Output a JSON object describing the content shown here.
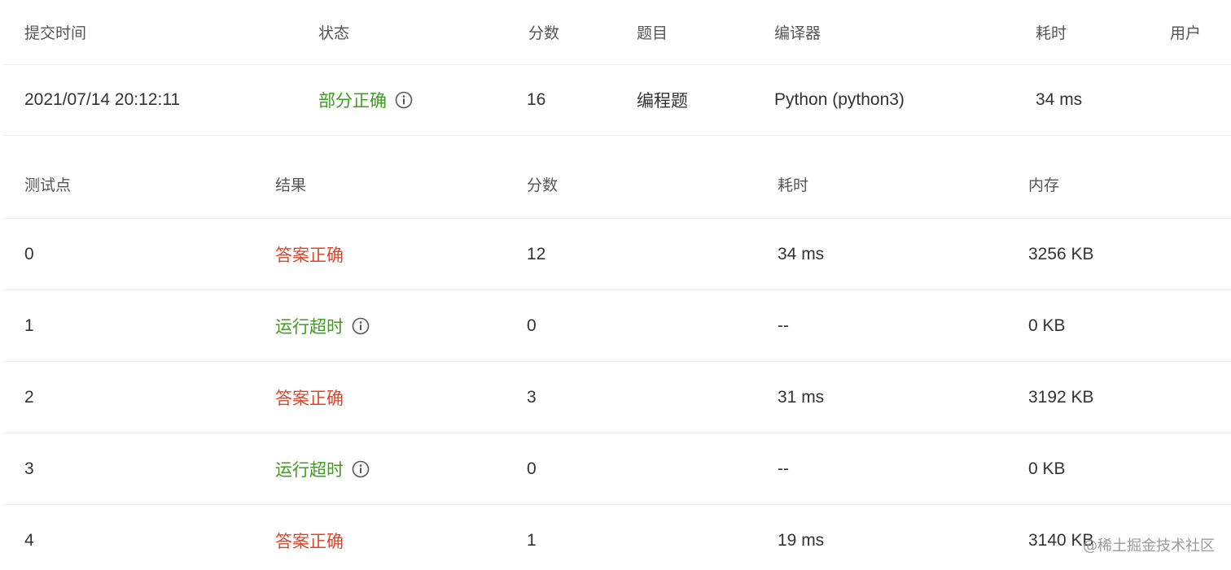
{
  "submission": {
    "headers": {
      "time": "提交时间",
      "status": "状态",
      "score": "分数",
      "problem": "题目",
      "compiler": "编译器",
      "duration": "耗时",
      "user": "用户"
    },
    "row": {
      "time": "2021/07/14 20:12:11",
      "status": "部分正确",
      "score": "16",
      "problem": "编程题",
      "compiler": "Python (python3)",
      "duration": "34 ms",
      "user": ""
    }
  },
  "testpoints": {
    "headers": {
      "id": "测试点",
      "result": "结果",
      "score": "分数",
      "duration": "耗时",
      "memory": "内存"
    },
    "rows": [
      {
        "id": "0",
        "result": "答案正确",
        "score": "12",
        "duration": "34 ms",
        "memory": "3256 KB"
      },
      {
        "id": "1",
        "result": "运行超时",
        "score": "0",
        "duration": "--",
        "memory": "0 KB"
      },
      {
        "id": "2",
        "result": "答案正确",
        "score": "3",
        "duration": "31 ms",
        "memory": "3192 KB"
      },
      {
        "id": "3",
        "result": "运行超时",
        "score": "0",
        "duration": "--",
        "memory": "0 KB"
      },
      {
        "id": "4",
        "result": "答案正确",
        "score": "1",
        "duration": "19 ms",
        "memory": "3140 KB"
      }
    ]
  },
  "icons": {
    "status_info": "info-circle-icon",
    "result_info": "info-circle-icon"
  },
  "colors": {
    "correct": "#e0442a",
    "partial_or_timeout": "#3c9d1e"
  },
  "watermark": "@稀土掘金技术社区"
}
